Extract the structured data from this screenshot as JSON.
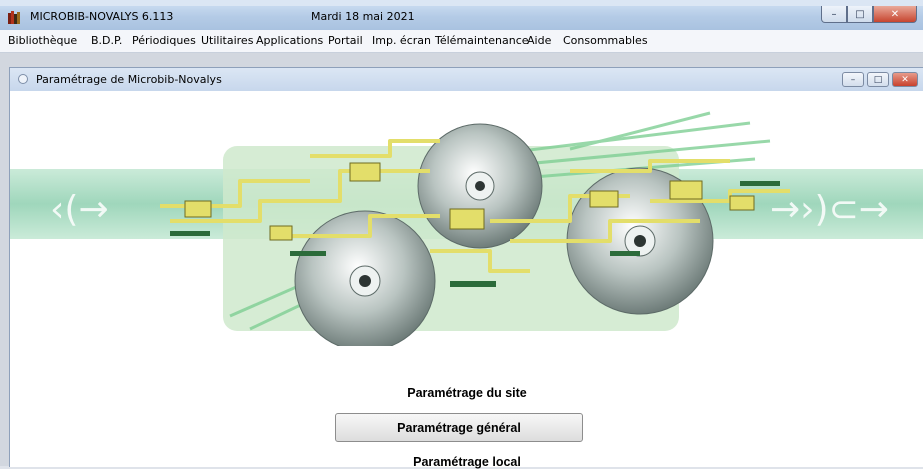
{
  "window": {
    "title": "MICROBIB-NOVALYS 6.113",
    "date": "Mardi 18 mai 2021",
    "minimize_glyph": "–",
    "maximize_glyph": "□",
    "close_glyph": "✕"
  },
  "menu": [
    "Bibliothèque",
    "B.D.P.",
    "Périodiques",
    "Utilitaires",
    "Applications",
    "Portail",
    "Imp. écran",
    "Télémaintenance",
    "Aide",
    "Consommables"
  ],
  "child_window": {
    "title": "Paramétrage de Microbib-Novalys",
    "minimize_glyph": "–",
    "maximize_glyph": "□",
    "close_glyph": "✕"
  },
  "banner": {
    "arrows_left": "‹(→",
    "arrows_right": "→›)⊂→",
    "colors": {
      "band": "#8fcfb0",
      "panel": "#cfe9cc",
      "circuit": "#e3de6a",
      "disc": "#c9d2cf"
    }
  },
  "content": {
    "section_title": "Paramétrage du site",
    "general_button": "Paramétrage général",
    "local_title": "Paramétrage local"
  }
}
